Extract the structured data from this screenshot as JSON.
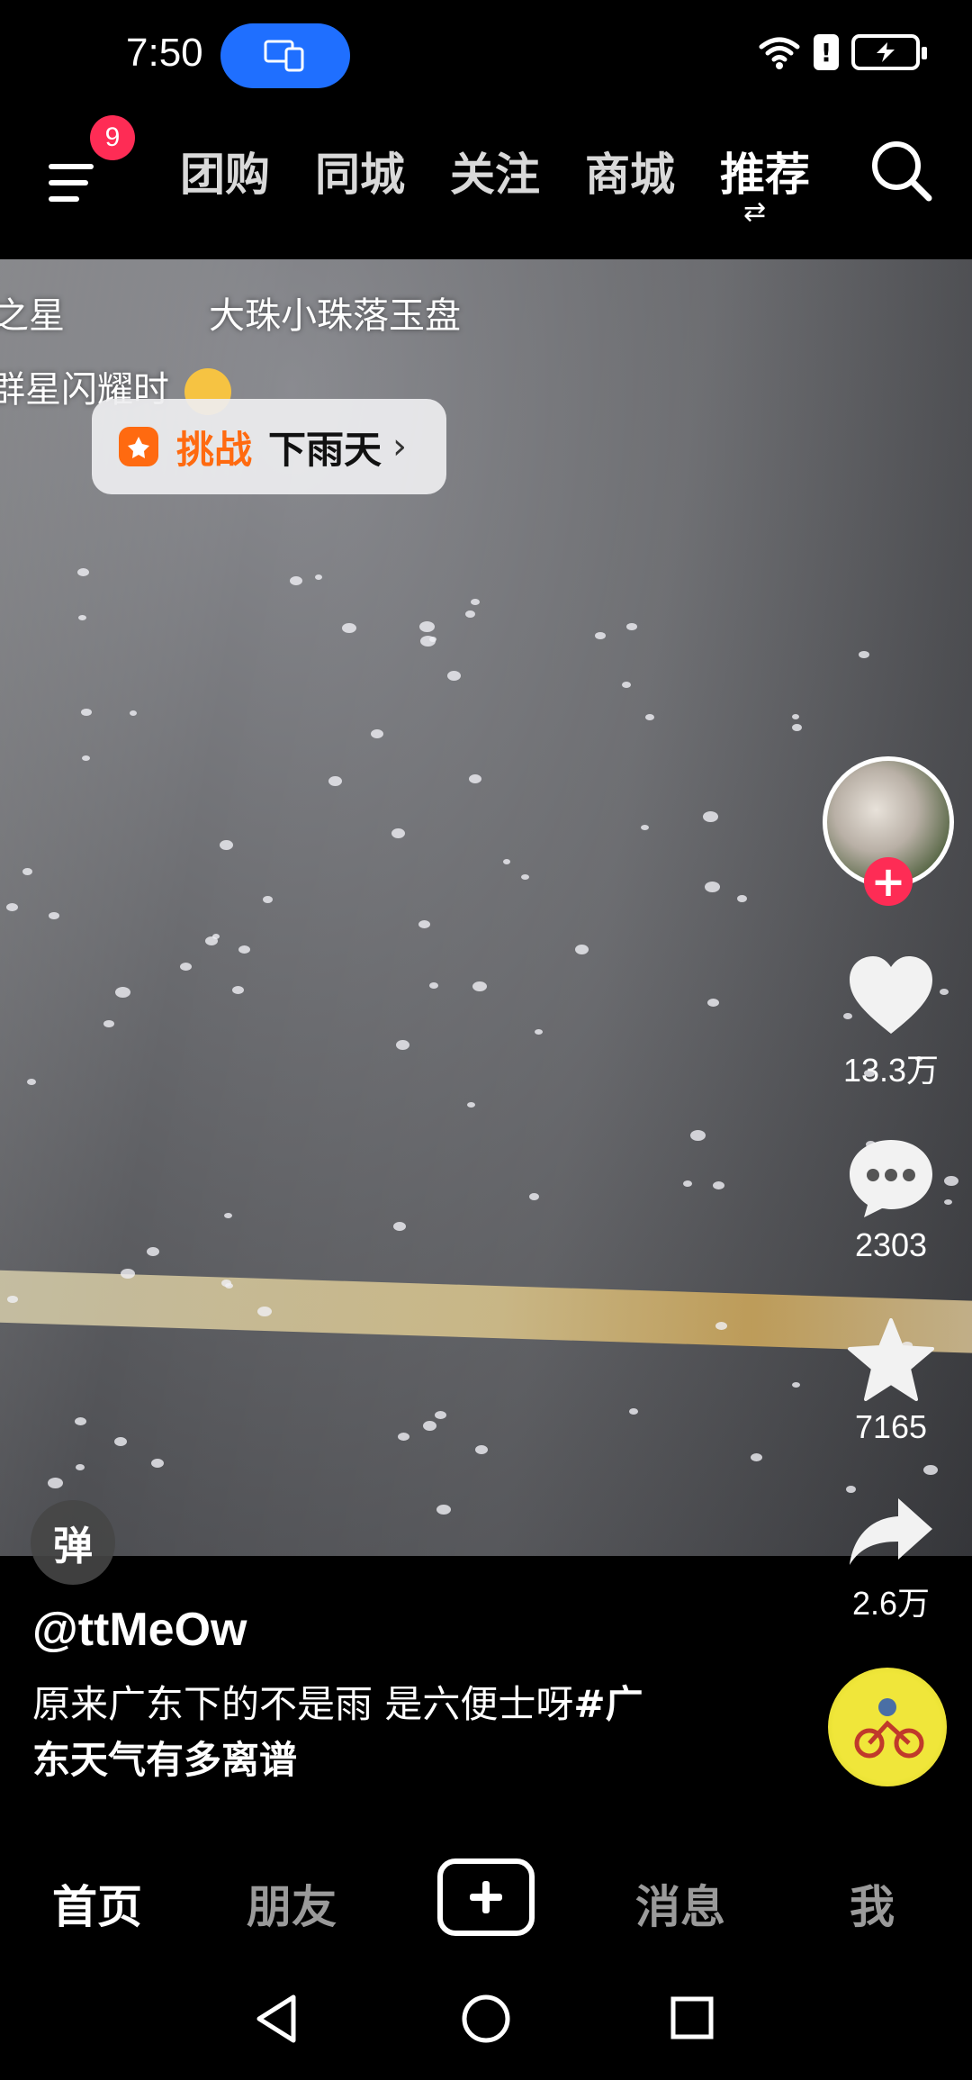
{
  "status_bar": {
    "time": "7:50",
    "icons": [
      "screen-cast-icon",
      "wifi-icon",
      "alert-icon",
      "battery-charging-icon"
    ]
  },
  "top_nav": {
    "menu_badge": "9",
    "tabs": [
      {
        "label": "团购",
        "active": false
      },
      {
        "label": "同城",
        "active": false
      },
      {
        "label": "关注",
        "active": false
      },
      {
        "label": "商城",
        "active": false
      },
      {
        "label": "推荐",
        "active": true
      }
    ],
    "switch_glyph": "⇄"
  },
  "video": {
    "lyrics": {
      "line1_left": "之星",
      "line1_right": "大珠小珠落玉盘",
      "line2": "群星闪耀时"
    },
    "challenge": {
      "label": "挑战",
      "topic": "下雨天",
      "arrow": "›"
    },
    "danmaku_label": "弹"
  },
  "actions": {
    "likes": "13.3万",
    "comments": "2303",
    "favorites": "7165",
    "shares": "2.6万"
  },
  "post": {
    "author": "@ttMeOw",
    "caption_text": "原来广东下的不是雨 是六便士呀",
    "caption_tag_part1": "#广",
    "caption_tag_part2": "东天气有多离谱"
  },
  "bottom_nav": {
    "items": [
      {
        "label": "首页",
        "active": true
      },
      {
        "label": "朋友",
        "active": false
      },
      {
        "label": "消息",
        "active": false
      },
      {
        "label": "我",
        "active": false
      }
    ]
  },
  "colors": {
    "accent_red": "#fe2c55",
    "challenge_orange": "#ff6a10",
    "cast_blue": "#1f6fff"
  }
}
